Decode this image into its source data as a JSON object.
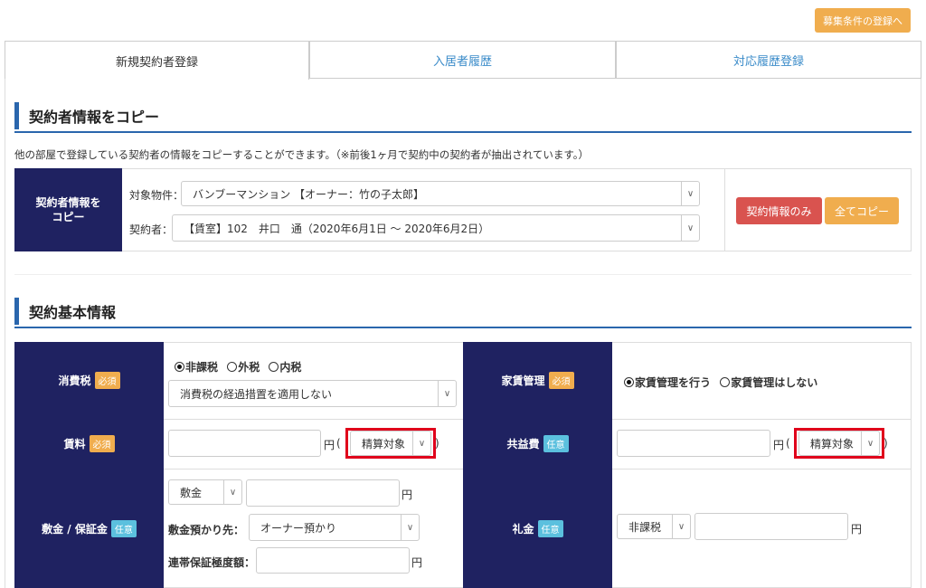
{
  "top_button": "募集条件の登録へ",
  "tabs": [
    {
      "label": "新規契約者登録"
    },
    {
      "label": "入居者履歴"
    },
    {
      "label": "対応履歴登録"
    }
  ],
  "copy_section": {
    "title": "契約者情報をコピー",
    "description": "他の部屋で登録している契約者の情報をコピーすることができます。（※前後1ヶ月で契約中の契約者が抽出されています。）",
    "header_line1": "契約者情報を",
    "header_line2": "コピー",
    "property_label": "対象物件：",
    "property_value": "バンブーマンション 【オーナー：竹の子太郎】",
    "contractor_label": "契約者：",
    "contractor_value": "【賃室】102　井口　通（2020年6月1日 ～ 2020年6月2日）",
    "btn_contract_only": "契約情報のみ",
    "btn_copy_all": "全てコピー"
  },
  "basic_section": {
    "title": "契約基本情報",
    "tax": {
      "label": "消費税",
      "badge": "必須",
      "radio1": "非課税",
      "radio2": "外税",
      "radio3": "内税",
      "select_value": "消費税の経過措置を適用しない"
    },
    "rent_mgmt": {
      "label": "家賃管理",
      "badge": "必須",
      "radio1": "家賃管理を行う",
      "radio2": "家賃管理はしない"
    },
    "rent": {
      "label": "賃料",
      "badge": "必須",
      "unit": "円",
      "paren_open": "(",
      "select_value": "精算対象",
      "paren_close": ")"
    },
    "common_fee": {
      "label": "共益費",
      "badge": "任意",
      "unit": "円",
      "paren_open": "(",
      "select_value": "精算対象",
      "paren_close": ")"
    },
    "deposit": {
      "label": "敷金 / 保証金",
      "badge": "任意",
      "type_value": "敷金",
      "unit": "円",
      "holder_label": "敷金預かり先：",
      "holder_value": "オーナー預かり",
      "guarantee_label": "連帯保証極度額：",
      "guarantee_unit": "円"
    },
    "key_money": {
      "label": "礼金",
      "badge": "任意",
      "tax_value": "非課税",
      "unit": "円"
    }
  }
}
